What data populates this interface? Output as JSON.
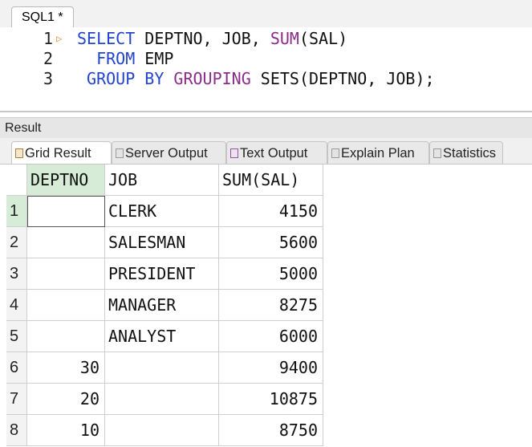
{
  "editor": {
    "tab_label": "SQL1 *",
    "lines": [
      {
        "no": "1",
        "tokens": [
          [
            "kw",
            "SELECT "
          ],
          [
            "tx",
            "DEPTNO, JOB, "
          ],
          [
            "fn",
            "SUM"
          ],
          [
            "tx",
            "(SAL)"
          ]
        ]
      },
      {
        "no": "2",
        "tokens": [
          [
            "kw",
            "  FROM "
          ],
          [
            "tx",
            "EMP"
          ]
        ]
      },
      {
        "no": "3",
        "tokens": [
          [
            "kw",
            " GROUP BY "
          ],
          [
            "fn",
            "GROUPING "
          ],
          [
            "tx",
            "SETS(DEPTNO, JOB);"
          ]
        ]
      }
    ]
  },
  "result": {
    "title": "Result",
    "tabs": [
      {
        "label": "Grid Result",
        "icon": "grid-icon",
        "active": true
      },
      {
        "label": "Server Output",
        "icon": "server-output-icon",
        "active": false
      },
      {
        "label": "Text Output",
        "icon": "text-output-icon",
        "active": false
      },
      {
        "label": "Explain Plan",
        "icon": "explain-plan-icon",
        "active": false
      },
      {
        "label": "Statistics",
        "icon": "statistics-icon",
        "active": false
      }
    ],
    "columns": [
      "DEPTNO",
      "JOB",
      "SUM(SAL)"
    ],
    "rows": [
      {
        "n": "1",
        "deptno": "",
        "job": "CLERK",
        "sum": "4150"
      },
      {
        "n": "2",
        "deptno": "",
        "job": "SALESMAN",
        "sum": "5600"
      },
      {
        "n": "3",
        "deptno": "",
        "job": "PRESIDENT",
        "sum": "5000"
      },
      {
        "n": "4",
        "deptno": "",
        "job": "MANAGER",
        "sum": "8275"
      },
      {
        "n": "5",
        "deptno": "",
        "job": "ANALYST",
        "sum": "6000"
      },
      {
        "n": "6",
        "deptno": "30",
        "job": "",
        "sum": "9400"
      },
      {
        "n": "7",
        "deptno": "20",
        "job": "",
        "sum": "10875"
      },
      {
        "n": "8",
        "deptno": "10",
        "job": "",
        "sum": "8750"
      }
    ]
  },
  "colors": {
    "keyword": "#2244cc",
    "function": "#8a2c8a",
    "selected_header": "#d6ecd6"
  }
}
